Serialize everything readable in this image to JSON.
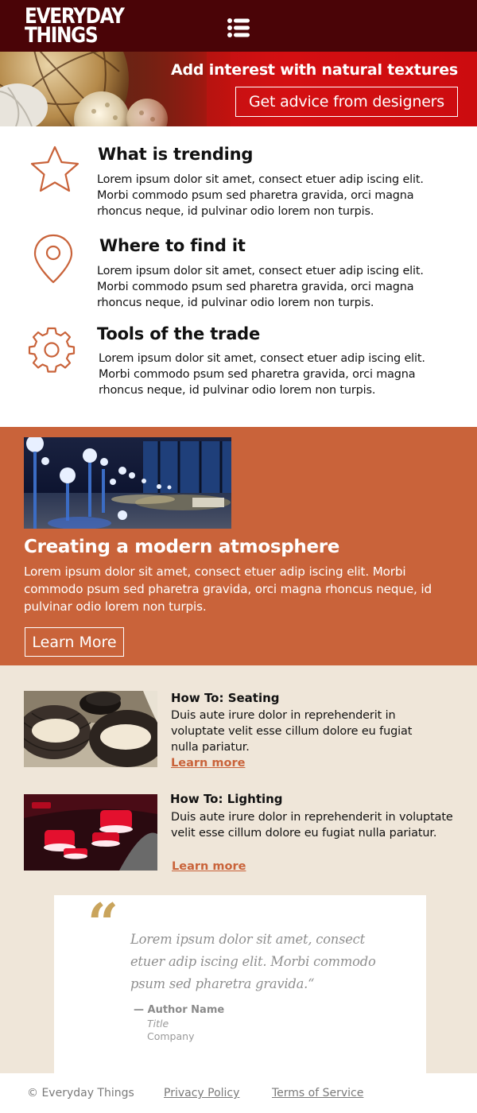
{
  "header": {
    "logo_line1": "EVERYDAY",
    "logo_line2": "THINGS",
    "hero_title": "Add interest with natural textures",
    "hero_button": "Get advice from designers"
  },
  "features": [
    {
      "icon": "star-icon",
      "title": "What is trending",
      "text": "Lorem ipsum dolor sit amet, consect etuer adip iscing elit. Morbi commodo psum sed pharetra gravida, orci magna rhoncus neque, id pulvinar odio lorem non turpis."
    },
    {
      "icon": "location-pin-icon",
      "title": "Where to find it",
      "text": "Lorem ipsum dolor sit amet, consect etuer adip iscing elit. Morbi commodo psum sed pharetra gravida, orci magna rhoncus neque, id pulvinar odio lorem non turpis."
    },
    {
      "icon": "gear-icon",
      "title": "Tools of the trade",
      "text": "Lorem ipsum dolor sit amet, consect etuer adip iscing elit. Morbi commodo psum sed pharetra gravida, orci magna rhoncus neque, id pulvinar odio lorem non turpis."
    }
  ],
  "highlight": {
    "title": "Creating a modern atmosphere",
    "text": "Lorem ipsum dolor sit amet, consect etuer adip iscing elit. Morbi commodo psum sed pharetra gravida, orci magna rhoncus neque, id pulvinar odio lorem non turpis.",
    "button": "Learn More"
  },
  "howtos": [
    {
      "title": "How To: Seating",
      "text": "Duis aute irure dolor in reprehenderit in voluptate velit esse cillum dolore eu fugiat nulla pariatur.",
      "link": "Learn more"
    },
    {
      "title": "How To: Lighting",
      "text": "Duis aute irure dolor in reprehenderit in voluptate velit esse cillum dolore eu fugiat nulla pariatur.",
      "link": "Learn more"
    }
  ],
  "testimonial": {
    "mark": "“",
    "quote": "Lorem ipsum dolor sit amet, consect etuer adip iscing elit. Morbi commodo psum sed pharetra gravida.“",
    "author": "— Author Name",
    "title": "Title",
    "company": "Company"
  },
  "footer": {
    "copyright": "© Everyday Things",
    "privacy": "Privacy Policy",
    "terms": "Terms of Service"
  },
  "colors": {
    "accent": "#c9633a",
    "header_dark": "#4a0407",
    "hero_red": "#d40f12",
    "beige": "#efe6d9",
    "quote_gold": "#c9a45c"
  }
}
